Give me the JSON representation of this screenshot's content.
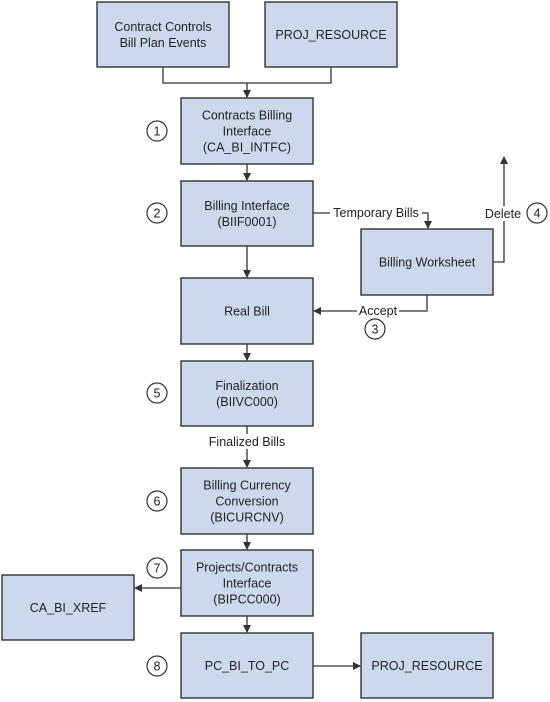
{
  "colors": {
    "box_fill": "#ccd9ec",
    "line": "#333333"
  },
  "boxes": {
    "contract_controls": [
      "Contract Controls",
      "Bill Plan Events"
    ],
    "proj_resource_top": [
      "PROJ_RESOURCE"
    ],
    "ca_bi_intfc": [
      "Contracts Billing",
      "Interface",
      "(CA_BI_INTFC)"
    ],
    "biif0001": [
      "Billing Interface",
      "(BIIF0001)"
    ],
    "real_bill": [
      "Real Bill"
    ],
    "billing_worksheet": [
      "Billing Worksheet"
    ],
    "finalization": [
      "Finalization",
      "(BIIVC000)"
    ],
    "bicurcnv": [
      "Billing Currency",
      "Conversion",
      "(BICURCNV)"
    ],
    "bipcc000": [
      "Projects/Contracts",
      "Interface",
      "(BIPCC000)"
    ],
    "ca_bi_xref": [
      "CA_BI_XREF"
    ],
    "pc_bi_to_pc": [
      "PC_BI_TO_PC"
    ],
    "proj_resource_bottom": [
      "PROJ_RESOURCE"
    ]
  },
  "edge_labels": {
    "temporary_bills": "Temporary Bills",
    "delete": "Delete",
    "accept": "Accept",
    "finalized_bills": "Finalized Bills"
  },
  "steps": [
    "1",
    "2",
    "3",
    "4",
    "5",
    "6",
    "7",
    "8"
  ]
}
